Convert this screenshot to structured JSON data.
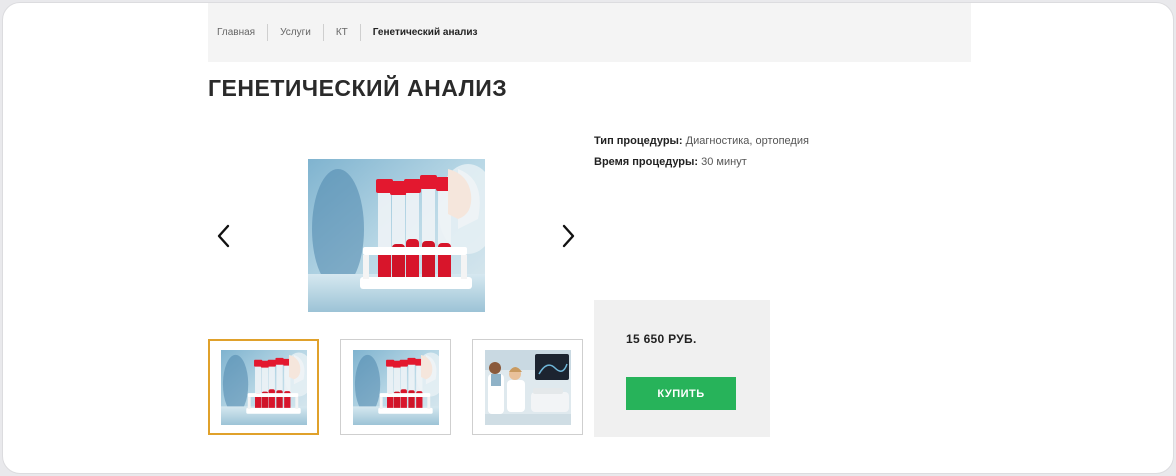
{
  "breadcrumb": {
    "items": [
      {
        "label": "Главная"
      },
      {
        "label": "Услуги"
      },
      {
        "label": "КТ"
      },
      {
        "label": "Генетический анализ"
      }
    ]
  },
  "page": {
    "title": "ГЕНЕТИЧЕСКИЙ АНАЛИЗ"
  },
  "gallery": {
    "main_image": "blood-test-tubes-photo",
    "prev_icon": "chevron-left-icon",
    "next_icon": "chevron-right-icon",
    "thumbnails": [
      {
        "image": "blood-test-tubes-photo",
        "active": true
      },
      {
        "image": "blood-test-tubes-photo",
        "active": false
      },
      {
        "image": "doctors-ultrasound-photo",
        "active": false
      }
    ]
  },
  "details": {
    "procedure_type_label": "Тип процедуры:",
    "procedure_type_value": "Диагностика, ортопедия",
    "procedure_time_label": "Время процедуры:",
    "procedure_time_value": "30 минут"
  },
  "purchase": {
    "price": "15 650 РУБ.",
    "buy_label": "КУПИТЬ",
    "buy_color": "#27b35a"
  }
}
